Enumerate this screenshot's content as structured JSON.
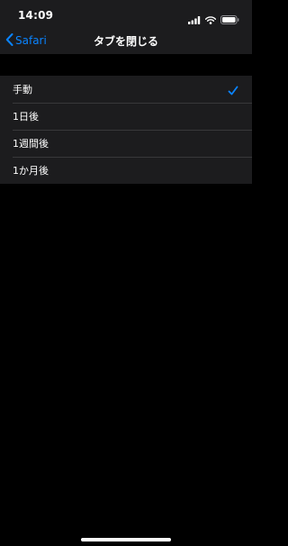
{
  "status_bar": {
    "time": "14:09",
    "icons": [
      "signal-icon",
      "wifi-icon",
      "battery-icon"
    ]
  },
  "nav": {
    "back_label": "Safari",
    "title": "タブを閉じる"
  },
  "options": [
    {
      "label": "手動",
      "selected": true
    },
    {
      "label": "1日後",
      "selected": false
    },
    {
      "label": "1週間後",
      "selected": false
    },
    {
      "label": "1か月後",
      "selected": false
    }
  ],
  "colors": {
    "accent": "#0a84ff",
    "background": "#000000",
    "grouped_background": "#1c1c1e",
    "separator": "#38383a",
    "text": "#ffffff"
  }
}
